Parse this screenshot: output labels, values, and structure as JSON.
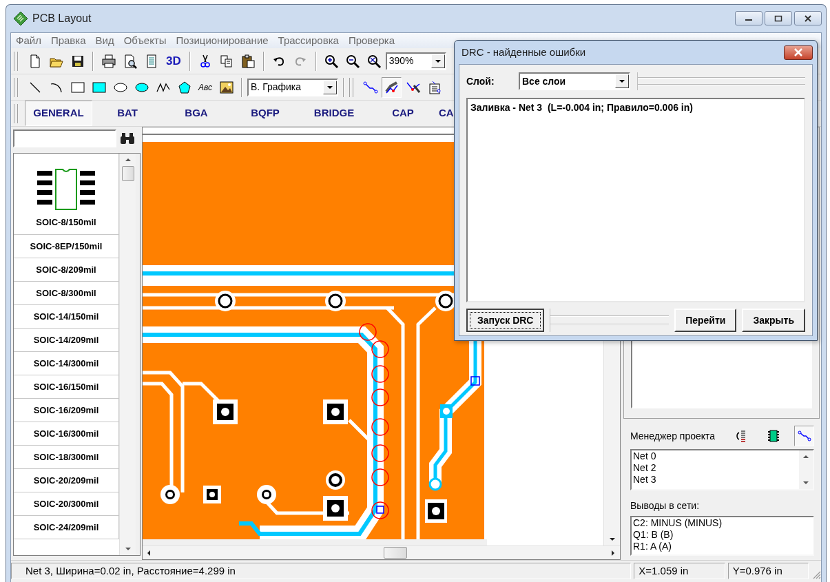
{
  "window": {
    "title": "PCB Layout"
  },
  "menu": [
    "Файл",
    "Правка",
    "Вид",
    "Объекты",
    "Позиционирование",
    "Трассировка",
    "Проверка"
  ],
  "toolbar": {
    "view_3d": "3D",
    "zoom": "390%",
    "text_tool": "Авс",
    "layer": "В. Графика"
  },
  "history": {
    "undo_disabled": false,
    "redo_disabled": true
  },
  "routing_tools": [
    {
      "pressed": false
    },
    {
      "pressed": true
    },
    {
      "pressed": false
    },
    {
      "pressed": false
    }
  ],
  "category_tabs": [
    {
      "label": "GENERAL",
      "selected": true
    },
    {
      "label": "BAT",
      "selected": false
    },
    {
      "label": "BGA",
      "selected": false
    },
    {
      "label": "BQFP",
      "selected": false
    },
    {
      "label": "BRIDGE",
      "selected": false
    },
    {
      "label": "CAP",
      "selected": false
    },
    {
      "label": "CA",
      "selected": false
    }
  ],
  "library": {
    "items": [
      {
        "name": "SOIC-8/150mil",
        "kind": "preview"
      },
      {
        "name": "SOIC-8EP/150mil",
        "kind": "plain"
      },
      {
        "name": "SOIC-8/209mil",
        "kind": "plain"
      },
      {
        "name": "SOIC-8/300mil",
        "kind": "plain"
      },
      {
        "name": "SOIC-14/150mil",
        "kind": "plain"
      },
      {
        "name": "SOIC-14/209mil",
        "kind": "plain"
      },
      {
        "name": "SOIC-14/300mil",
        "kind": "plain"
      },
      {
        "name": "SOIC-16/150mil",
        "kind": "plain"
      },
      {
        "name": "SOIC-16/209mil",
        "kind": "plain"
      },
      {
        "name": "SOIC-16/300mil",
        "kind": "plain"
      },
      {
        "name": "SOIC-18/300mil",
        "kind": "plain"
      },
      {
        "name": "SOIC-20/209mil",
        "kind": "plain"
      },
      {
        "name": "SOIC-20/300mil",
        "kind": "plain"
      },
      {
        "name": "SOIC-24/209mil",
        "kind": "plain"
      }
    ]
  },
  "drc": {
    "title": "DRC - найденные ошибки",
    "layer_label": "Слой:",
    "layer": "Все слои",
    "errors": [
      "Заливка - Net 3  (L=-0.004 in; Правило=0.006 in)"
    ],
    "buttons": [
      {
        "label": "Запуск DRC",
        "focused": true
      },
      {
        "label": "Перейти",
        "focused": false
      },
      {
        "label": "Закрыть",
        "focused": false
      }
    ]
  },
  "project_manager": {
    "title": "Менеджер проекта",
    "view_buttons": [
      {
        "selected": false
      },
      {
        "selected": false
      },
      {
        "selected": true
      }
    ],
    "nets": [
      "Net 0",
      "Net 2",
      "Net 3"
    ],
    "pins_label": "Выводы в сети:",
    "pins": [
      "C2: MINUS (MINUS)",
      "Q1: B (B)",
      "R1: A (A)"
    ]
  },
  "status_bar": {
    "message": "Net 3, Ширина=0.02 in, Расстояние=4.299 in",
    "x": "X=1.059 in",
    "y": "Y=0.976 in"
  }
}
